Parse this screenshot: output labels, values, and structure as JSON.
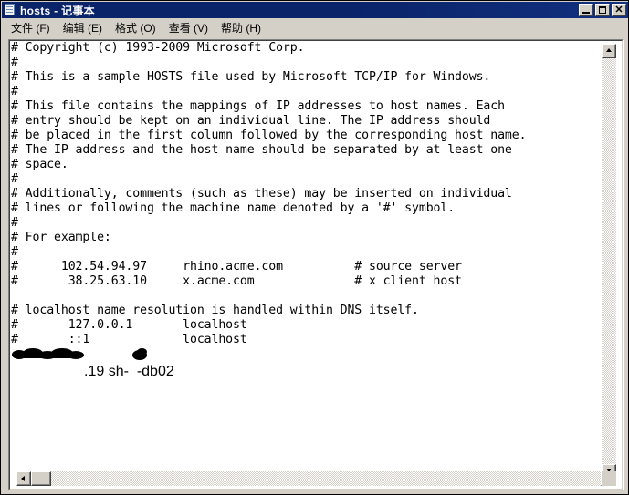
{
  "window": {
    "title": "hosts - 记事本",
    "icon": "notepad-document-icon",
    "colors": {
      "titlebar": "#0a246a",
      "chrome": "#d4d0c8",
      "text_bg": "#ffffff",
      "text_fg": "#000000"
    }
  },
  "titlebar_buttons": {
    "minimize": "_",
    "maximize": "□",
    "close": "✕"
  },
  "menu": {
    "items": [
      {
        "label": "文件 (F)"
      },
      {
        "label": "编辑 (E)"
      },
      {
        "label": "格式 (O)"
      },
      {
        "label": "查看 (V)"
      },
      {
        "label": "帮助 (H)"
      }
    ]
  },
  "editor": {
    "lines": [
      "# Copyright (c) 1993-2009 Microsoft Corp.",
      "#",
      "# This is a sample HOSTS file used by Microsoft TCP/IP for Windows.",
      "#",
      "# This file contains the mappings of IP addresses to host names. Each",
      "# entry should be kept on an individual line. The IP address should",
      "# be placed in the first column followed by the corresponding host name.",
      "# The IP address and the host name should be separated by at least one",
      "# space.",
      "#",
      "# Additionally, comments (such as these) may be inserted on individual",
      "# lines or following the machine name denoted by a '#' symbol.",
      "#",
      "# For example:",
      "#",
      "#      102.54.94.97     rhino.acme.com          # source server",
      "#       38.25.63.10     x.acme.com              # x client host",
      "",
      "# localhost name resolution is handled within DNS itself.",
      "#       127.0.0.1       localhost",
      "#       ::1             localhost"
    ],
    "redacted_line": {
      "prefix_redacted": true,
      "visible_suffix": ".19 sh-",
      "middle_redacted": true,
      "tail": "-db02"
    }
  },
  "scrollbars": {
    "vertical": {
      "up_arrow": "scroll-up-arrow-icon",
      "down_arrow": "scroll-down-arrow-icon"
    },
    "horizontal": {
      "left_arrow": "scroll-left-arrow-icon",
      "right_arrow": "scroll-right-arrow-icon"
    }
  }
}
